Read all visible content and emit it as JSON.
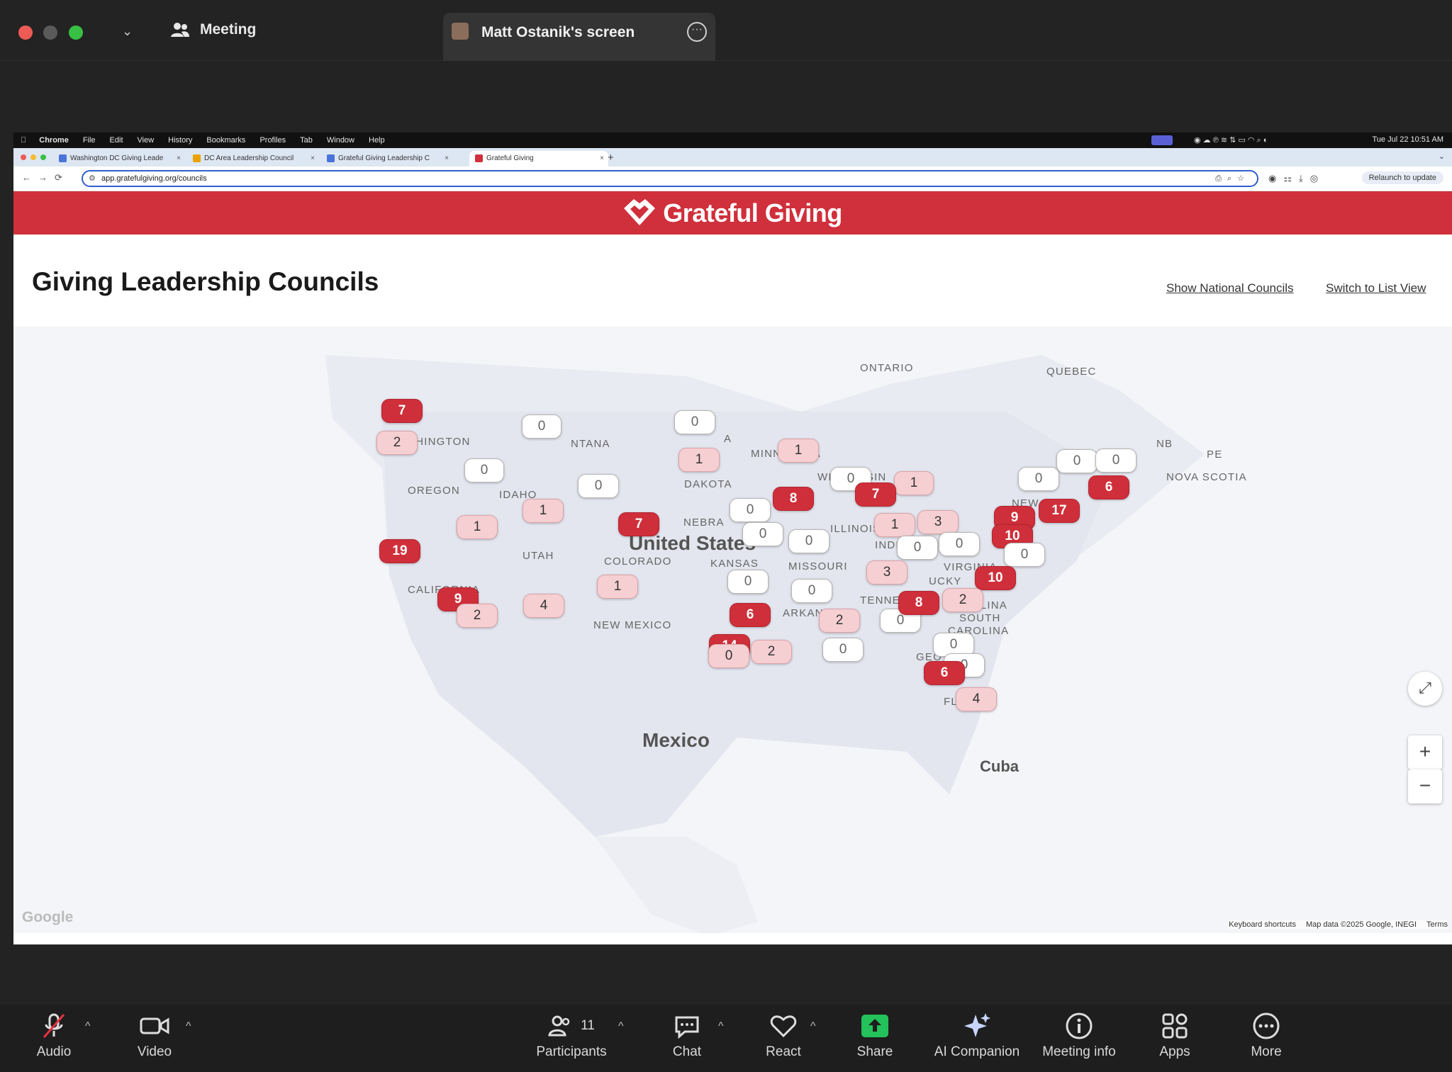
{
  "zoom": {
    "meeting_label": "Meeting",
    "share_title": "Matt Ostanik's screen",
    "toolbar": [
      {
        "label": "Audio",
        "icon": "mic-muted-icon"
      },
      {
        "label": "Video",
        "icon": "video-icon"
      },
      {
        "label": "Participants",
        "icon": "participants-icon",
        "count": "11"
      },
      {
        "label": "Chat",
        "icon": "chat-icon"
      },
      {
        "label": "React",
        "icon": "heart-icon"
      },
      {
        "label": "Share",
        "icon": "share-icon"
      },
      {
        "label": "AI Companion",
        "icon": "sparkle-icon"
      },
      {
        "label": "Meeting info",
        "icon": "info-icon"
      },
      {
        "label": "Apps",
        "icon": "apps-icon"
      },
      {
        "label": "More",
        "icon": "more-icon"
      }
    ]
  },
  "mac_menu": {
    "items": [
      "Chrome",
      "File",
      "Edit",
      "View",
      "History",
      "Bookmarks",
      "Profiles",
      "Tab",
      "Window",
      "Help"
    ],
    "clock": "Tue Jul 22  10:51 AM"
  },
  "browser": {
    "tabs": [
      {
        "label": "Washington DC Giving Leade",
        "color": "#4a74d9"
      },
      {
        "label": "DC Area Leadership Council",
        "color": "#e8a300"
      },
      {
        "label": "Grateful Giving Leadership C",
        "color": "#4a74d9"
      },
      {
        "label": "Grateful Giving",
        "color": "#cf303b"
      }
    ],
    "url": "app.gratefulgiving.org/councils",
    "relaunch": "Relaunch to update"
  },
  "site": {
    "brand": "Grateful Giving",
    "brand_color": "#cf303b",
    "title": "Giving Leadership Councils",
    "links": [
      "Show National Councils",
      "Switch to List View"
    ]
  },
  "map": {
    "labels": [
      "ONTARIO",
      "QUEBEC",
      "WASHINGTON",
      "NTANA",
      "A",
      "MINNESOTA",
      "WISCONSIN",
      "NB",
      "PE",
      "NOVA SCOTIA",
      "OREGON",
      "IDAHO",
      "DAKOTA",
      "NEW YOR",
      "UTAH",
      "NEBRA",
      "ILLINOIS",
      "INDIANA",
      "COLORADO",
      "KANSAS",
      "MISSOURI",
      "VIRGINIA",
      "CALIFORNIA",
      "TENNESSEE",
      "UCKY",
      "OLINA",
      "NEW MEXICO",
      "ARKANSAS",
      "SOUTH",
      "CAROLINA",
      "GEO",
      "FLORIDA",
      "Mexico",
      "Cuba",
      "United States"
    ],
    "pins": [
      "7",
      "0",
      "0",
      "2",
      "1",
      "0",
      "0",
      "1",
      "0",
      "1",
      "0",
      "0",
      "1",
      "0",
      "7",
      "8",
      "0",
      "6",
      "1",
      "7",
      "0",
      "17",
      "1",
      "9",
      "3",
      "0",
      "1",
      "0",
      "0",
      "10",
      "19",
      "0",
      "0",
      "3",
      "1",
      "0",
      "0",
      "10",
      "9",
      "4",
      "1",
      "0",
      "6",
      "8",
      "2",
      "2",
      "0",
      "0",
      "2",
      "14",
      "2",
      "0",
      "0",
      "6",
      "4"
    ],
    "google": "Google",
    "footer": [
      "Keyboard shortcuts",
      "Map data ©2025 Google, INEGI",
      "Terms"
    ]
  }
}
